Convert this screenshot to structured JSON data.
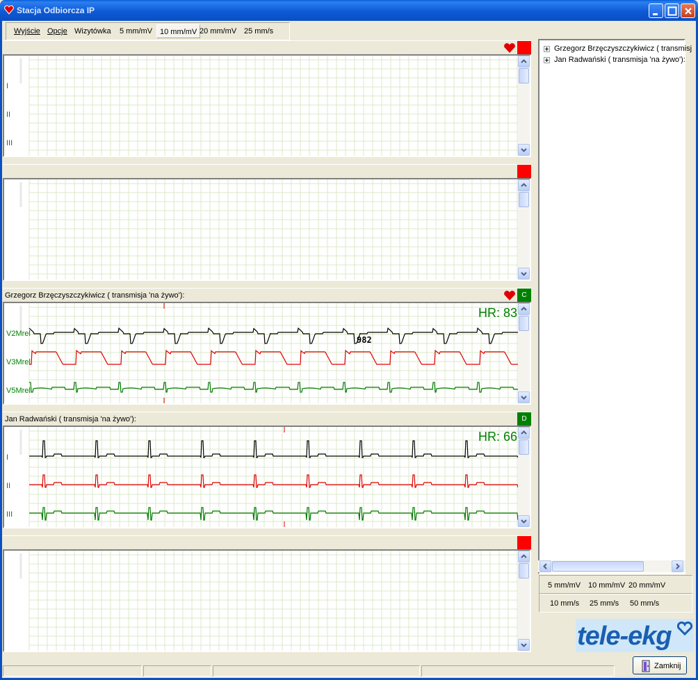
{
  "window": {
    "title": "Stacja Odbiorcza IP"
  },
  "toolbar": {
    "items": [
      {
        "label": "Wyjście"
      },
      {
        "label": "Opcje"
      },
      {
        "label": "Wizytówka"
      },
      {
        "label": "5 mm/mV"
      },
      {
        "label": "10 mm/mV",
        "pressed": true
      },
      {
        "label": "20 mm/mV"
      },
      {
        "label": "25 mm/s"
      }
    ]
  },
  "panels": [
    {
      "title": "",
      "status": "red",
      "heart": true,
      "leads": [
        "I",
        "II",
        "III"
      ],
      "hr": "",
      "trace": "none"
    },
    {
      "title": "",
      "status": "red",
      "heart": false,
      "leads": [],
      "hr": "",
      "trace": "none"
    },
    {
      "title": "Grzegorz Brzęczyszczykiwicz ( transmisja 'na żywo'):",
      "status": "green",
      "status_letter": "C",
      "heart": true,
      "leads": [
        "V2Mrel",
        "V3Mrel",
        "V5Mrel"
      ],
      "hr": "HR: 83",
      "annotation": "982",
      "trace": "wide"
    },
    {
      "title": "Jan Radwański ( transmisja 'na żywo'):",
      "status": "green",
      "status_letter": "D",
      "heart": false,
      "leads": [
        "I",
        "II",
        "III"
      ],
      "hr": "HR: 66",
      "trace": "narrow"
    },
    {
      "title": "",
      "status": "red",
      "heart": false,
      "leads": [],
      "hr": "",
      "trace": "none"
    }
  ],
  "tree": {
    "items": [
      {
        "label": "Grzegorz Brzęczyszczykiwicz ( transmisj"
      },
      {
        "label": "Jan Radwański ( transmisja 'na żywo'):"
      }
    ]
  },
  "gain_bar": {
    "items": [
      "5 mm/mV",
      "10 mm/mV",
      "20 mm/mV"
    ]
  },
  "speed_bar": {
    "items": [
      "10 mm/s",
      "25 mm/s",
      "50 mm/s"
    ]
  },
  "logo": {
    "text": "tele-ekg"
  },
  "buttons": {
    "close_label": "Zamknij"
  },
  "colors": {
    "lead1": "#000000",
    "lead2": "#e00000",
    "lead3": "#007a00",
    "grid": "#dbe8c8",
    "status_red": "#ff0000",
    "status_green": "#008000"
  }
}
